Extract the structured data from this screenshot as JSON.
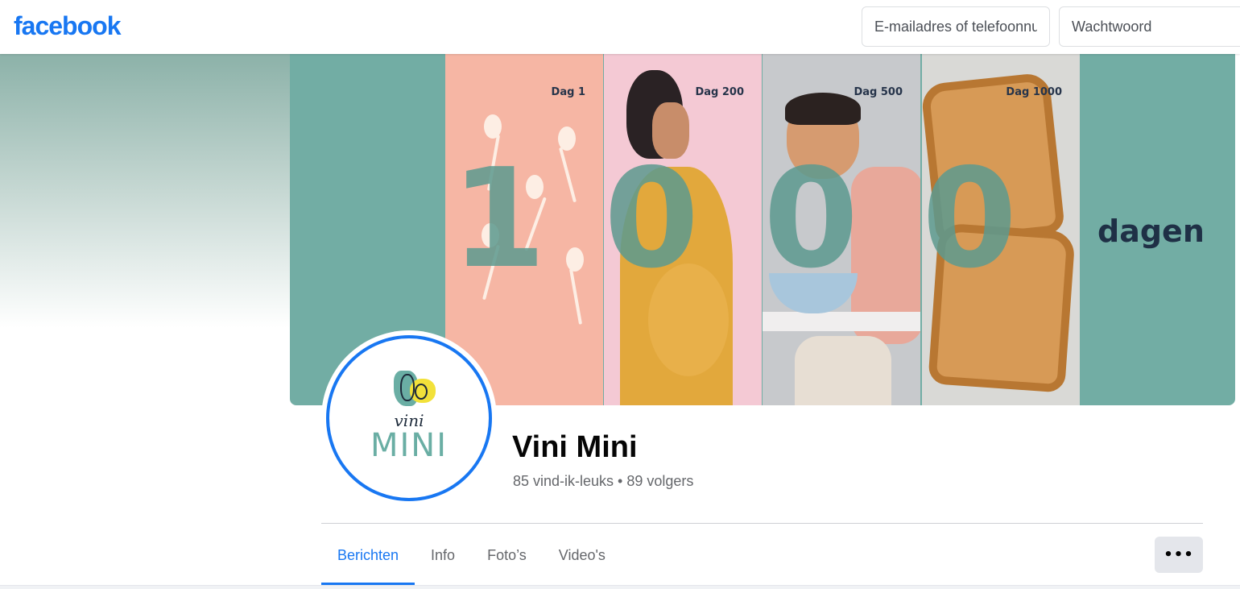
{
  "header": {
    "logo_text": "facebook",
    "email_placeholder": "E-mailadres of telefoonnummer",
    "password_placeholder": "Wachtwoord"
  },
  "cover": {
    "panels": [
      {
        "label": "Dag 1"
      },
      {
        "label": "Dag 200"
      },
      {
        "label": "Dag 500"
      },
      {
        "label": "Dag 1000"
      }
    ],
    "big_number": [
      "1",
      "0",
      "0",
      "0"
    ],
    "caption": "dagen"
  },
  "avatar": {
    "brand_top": "vini",
    "brand_bottom": "MINI"
  },
  "page": {
    "title": "Vini Mini",
    "stats": "85 vind-ik-leuks • 89 volgers"
  },
  "tabs": [
    {
      "label": "Berichten",
      "active": true
    },
    {
      "label": "Info",
      "active": false
    },
    {
      "label": "Foto’s",
      "active": false
    },
    {
      "label": "Video's",
      "active": false
    }
  ],
  "more_button": {
    "label": "•••"
  },
  "colors": {
    "brand_blue": "#1877f2",
    "cover_teal": "#72ada4",
    "secondary_text": "#65676b"
  }
}
